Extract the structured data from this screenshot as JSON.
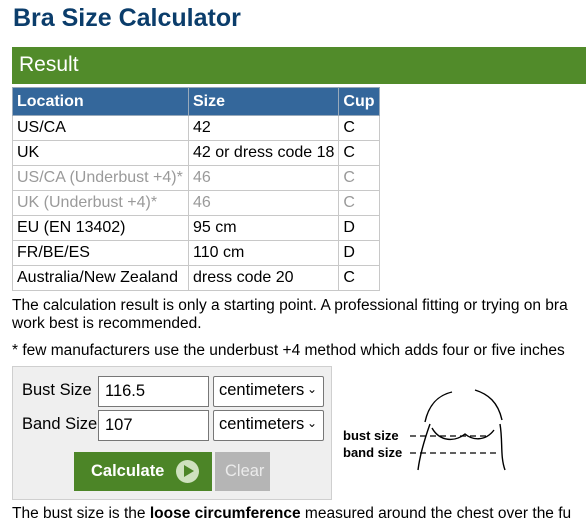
{
  "page": {
    "title": "Bra Size Calculator"
  },
  "result": {
    "heading": "Result",
    "columns": [
      "Location",
      "Size",
      "Cup"
    ],
    "rows": [
      {
        "location": "US/CA",
        "size": "42",
        "cup": "C"
      },
      {
        "location": "UK",
        "size": "42 or dress code 18",
        "cup": "C"
      },
      {
        "location": "US/CA (Underbust +4)*",
        "size": "46",
        "cup": "C"
      },
      {
        "location": "UK (Underbust +4)*",
        "size": "46",
        "cup": "C"
      },
      {
        "location": "EU (EN 13402)",
        "size": "95 cm",
        "cup": "D"
      },
      {
        "location": "FR/BE/ES",
        "size": "110 cm",
        "cup": "D"
      },
      {
        "location": "Australia/New Zealand",
        "size": "dress code 20",
        "cup": "C"
      }
    ],
    "note_line1": "The calculation result is only a starting point. A professional fitting or trying on bra",
    "note_line2": "work best is recommended.",
    "footnote": "* few manufacturers use the underbust +4 method which adds four or five inches"
  },
  "form": {
    "bust_label": "Bust Size",
    "bust_value": "116.5",
    "bust_unit": "centimeters",
    "band_label": "Band Size",
    "band_value": "107",
    "band_unit": "centimeters",
    "calculate_label": "Calculate",
    "clear_label": "Clear"
  },
  "diagram": {
    "bust_label": "bust size",
    "band_label": "band size"
  },
  "bottom": {
    "prefix": "The bust size is the ",
    "bold": "loose circumference",
    "suffix": " measured around the chest over the fu"
  },
  "colors": {
    "title": "#0b3d6b",
    "result_bar": "#518b2a",
    "table_header": "#34679b",
    "calculate_button": "#4c8527",
    "clear_button": "#b5b5b5"
  }
}
